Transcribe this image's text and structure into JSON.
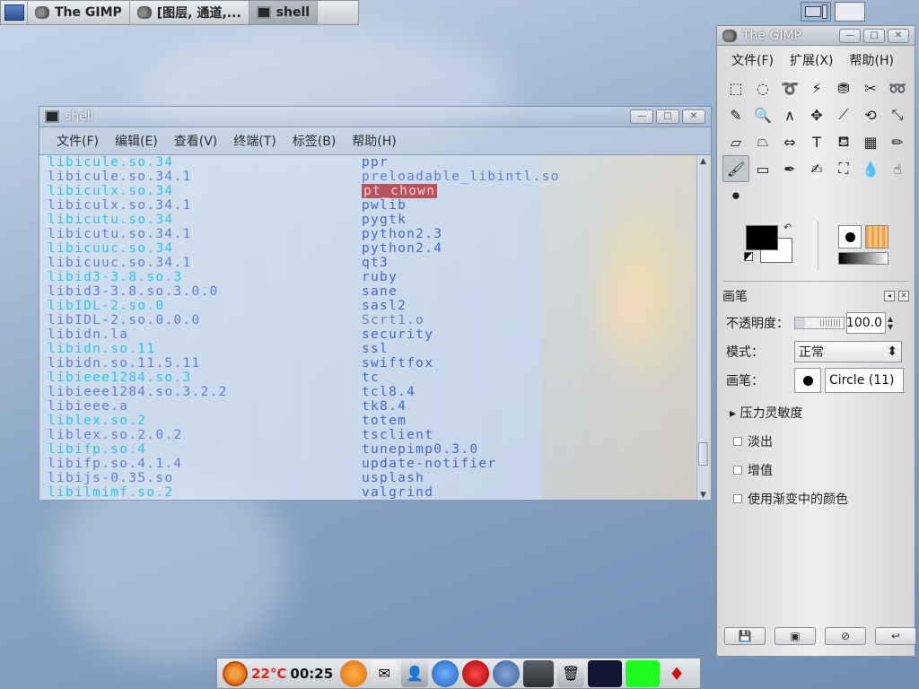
{
  "taskbar": {
    "tasks": [
      {
        "label": "The GIMP"
      },
      {
        "label": "[图层, 通道,..."
      },
      {
        "label": "shell"
      }
    ]
  },
  "shell": {
    "title": "shell",
    "menu": [
      "文件(F)",
      "编辑(E)",
      "查看(V)",
      "终端(T)",
      "标签(B)",
      "帮助(H)"
    ],
    "col1": [
      {
        "t": "libicule.so.34",
        "c": "cyan"
      },
      {
        "t": "libicule.so.34.1",
        "c": "file"
      },
      {
        "t": "libiculx.so.34",
        "c": "cyan"
      },
      {
        "t": "libiculx.so.34.1",
        "c": "file"
      },
      {
        "t": "libicutu.so.34",
        "c": "cyan"
      },
      {
        "t": "libicutu.so.34.1",
        "c": "file"
      },
      {
        "t": "libicuuc.so.34",
        "c": "cyan"
      },
      {
        "t": "libicuuc.so.34.1",
        "c": "file"
      },
      {
        "t": "libid3-3.8.so.3",
        "c": "cyan"
      },
      {
        "t": "libid3-3.8.so.3.0.0",
        "c": "file"
      },
      {
        "t": "libIDL-2.so.0",
        "c": "cyan"
      },
      {
        "t": "libIDL-2.so.0.0.0",
        "c": "file"
      },
      {
        "t": "libidn.la",
        "c": "file"
      },
      {
        "t": "libidn.so.11",
        "c": "cyan"
      },
      {
        "t": "libidn.so.11.5.11",
        "c": "file"
      },
      {
        "t": "libieee1284.so.3",
        "c": "cyan"
      },
      {
        "t": "libieee1284.so.3.2.2",
        "c": "file"
      },
      {
        "t": "libieee.a",
        "c": "file"
      },
      {
        "t": "liblex.so.2",
        "c": "cyan"
      },
      {
        "t": "liblex.so.2.0.2",
        "c": "file"
      },
      {
        "t": "libifp.so.4",
        "c": "cyan"
      },
      {
        "t": "libifp.so.4.1.4",
        "c": "file"
      },
      {
        "t": "libijs-0.35.so",
        "c": "file"
      },
      {
        "t": "libilmimf.so.2",
        "c": "cyan"
      }
    ],
    "col2": [
      {
        "t": "ppr",
        "c": "blue"
      },
      {
        "t": "preloadable_libintl.so",
        "c": "file"
      },
      {
        "t": "pt_chown",
        "c": "hl"
      },
      {
        "t": "pwlib",
        "c": "blue"
      },
      {
        "t": "pygtk",
        "c": "blue"
      },
      {
        "t": "python2.3",
        "c": "blue"
      },
      {
        "t": "python2.4",
        "c": "blue"
      },
      {
        "t": "qt3",
        "c": "blue"
      },
      {
        "t": "ruby",
        "c": "blue"
      },
      {
        "t": "sane",
        "c": "blue"
      },
      {
        "t": "sasl2",
        "c": "blue"
      },
      {
        "t": "Scrt1.o",
        "c": "dim"
      },
      {
        "t": "security",
        "c": "blue"
      },
      {
        "t": "ssl",
        "c": "blue"
      },
      {
        "t": "swiftfox",
        "c": "blue"
      },
      {
        "t": "tc",
        "c": "blue"
      },
      {
        "t": "tcl8.4",
        "c": "blue"
      },
      {
        "t": "tk8.4",
        "c": "blue"
      },
      {
        "t": "totem",
        "c": "blue"
      },
      {
        "t": "tsclient",
        "c": "blue"
      },
      {
        "t": "tunepimp0.3.0",
        "c": "blue"
      },
      {
        "t": "update-notifier",
        "c": "blue"
      },
      {
        "t": "usplash",
        "c": "blue"
      },
      {
        "t": "valgrind",
        "c": "blue"
      }
    ]
  },
  "gimp": {
    "title": "The GIMP",
    "menu": [
      "文件(F)",
      "扩展(X)",
      "帮助(H)"
    ],
    "tools": [
      {
        "icon": "rect-select-icon",
        "g": "⬚"
      },
      {
        "icon": "ellipse-select-icon",
        "g": "◌"
      },
      {
        "icon": "lasso-icon",
        "g": "➰"
      },
      {
        "icon": "magic-wand-icon",
        "g": "⚡"
      },
      {
        "icon": "color-select-icon",
        "g": "⛃"
      },
      {
        "icon": "scissors-icon",
        "g": "✂"
      },
      {
        "icon": "paths-icon",
        "g": "➿"
      },
      {
        "icon": "color-picker-icon",
        "g": "✎"
      },
      {
        "icon": "zoom-icon",
        "g": "🔍"
      },
      {
        "icon": "measure-icon",
        "g": "∧"
      },
      {
        "icon": "move-icon",
        "g": "✥"
      },
      {
        "icon": "crop-icon",
        "g": "⟋"
      },
      {
        "icon": "rotate-icon",
        "g": "⟲"
      },
      {
        "icon": "scale-icon",
        "g": "⤡"
      },
      {
        "icon": "shear-icon",
        "g": "▱"
      },
      {
        "icon": "perspective-icon",
        "g": "⏢"
      },
      {
        "icon": "flip-icon",
        "g": "⇔"
      },
      {
        "icon": "text-icon",
        "g": "T"
      },
      {
        "icon": "bucket-fill-icon",
        "g": "⛾"
      },
      {
        "icon": "blend-icon",
        "g": "▦"
      },
      {
        "icon": "pencil-icon",
        "g": "✏"
      },
      {
        "icon": "paintbrush-icon",
        "g": "🖌"
      },
      {
        "icon": "eraser-icon",
        "g": "▭"
      },
      {
        "icon": "airbrush-icon",
        "g": "✒"
      },
      {
        "icon": "ink-icon",
        "g": "✍"
      },
      {
        "icon": "clone-icon",
        "g": "⛶"
      },
      {
        "icon": "blur-icon",
        "g": "💧"
      },
      {
        "icon": "smudge-icon",
        "g": "☝"
      },
      {
        "icon": "dodge-burn-icon",
        "g": "⚫"
      }
    ],
    "options": {
      "title": "画笔",
      "opacity_label": "不透明度：",
      "opacity_value": "100.0",
      "mode_label": "模式：",
      "mode_value": "正常",
      "brush_label": "画笔：",
      "brush_value": "Circle (11)",
      "pressure_label": "压力灵敏度",
      "fade_label": "淡出",
      "increment_label": "增值",
      "gradient_label": "使用渐变中的颜色"
    },
    "colors": {
      "foreground": "#000000",
      "background": "#ffffff"
    }
  },
  "dock": {
    "temperature": "22°C",
    "time": "00:25"
  }
}
